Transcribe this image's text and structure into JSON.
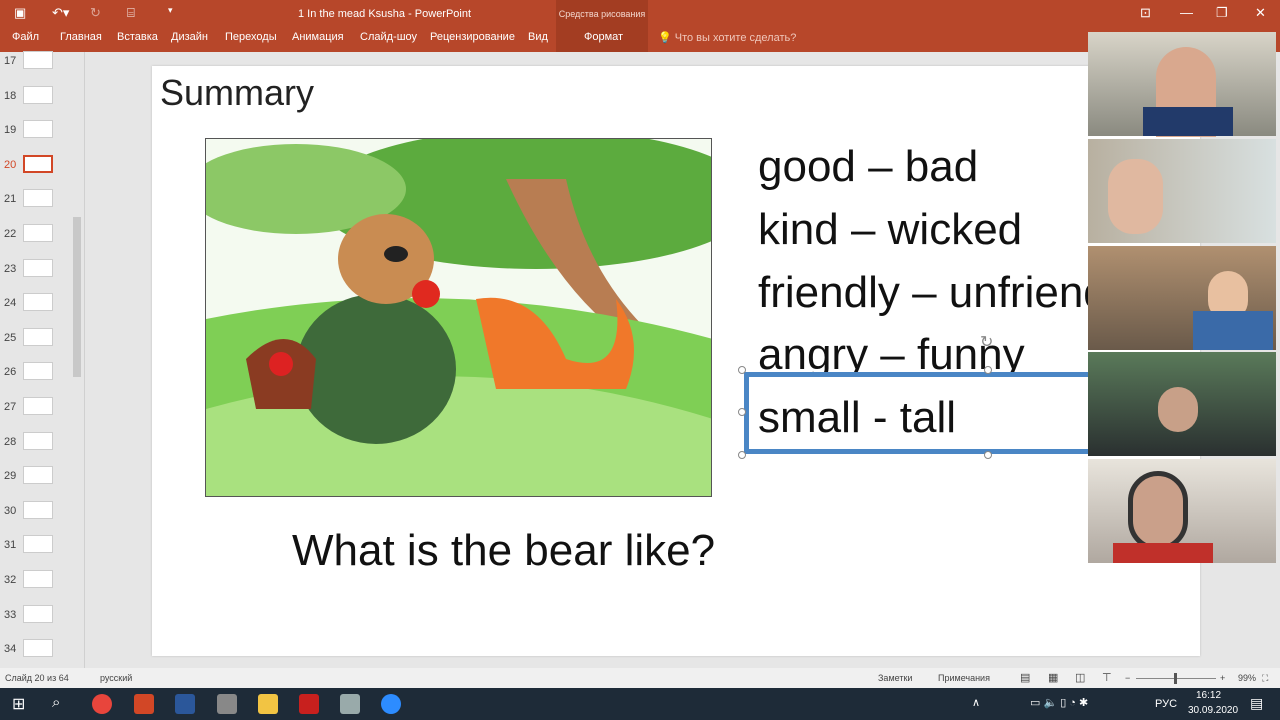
{
  "window": {
    "title": "1 In the mead Ksusha - PowerPoint",
    "context_group": "Средства рисования"
  },
  "ribbon": {
    "tabs": [
      "Файл",
      "Главная",
      "Вставка",
      "Дизайн",
      "Переходы",
      "Анимация",
      "Слайд-шоу",
      "Рецензирование",
      "Вид",
      "Формат"
    ],
    "search": "Что вы хотите сделать?"
  },
  "thumbnails": [
    "17",
    "18",
    "19",
    "20",
    "21",
    "22",
    "23",
    "24",
    "25",
    "26",
    "27",
    "28",
    "29",
    "30",
    "31",
    "32",
    "33",
    "34"
  ],
  "selected_slide": "20",
  "slide": {
    "title": "Summary",
    "words": [
      "good – bad",
      "kind – wicked",
      "friendly – unfriendly",
      "angry – funny",
      "small - tall"
    ],
    "question": "What is the bear like?"
  },
  "status": {
    "slide_info": "Слайд 20 из 64",
    "language": "русский",
    "notes": "Заметки",
    "comments": "Примечания",
    "zoom": "99%"
  },
  "taskbar": {
    "lang": "РУС",
    "time": "16:12",
    "date": "30.09.2020"
  }
}
